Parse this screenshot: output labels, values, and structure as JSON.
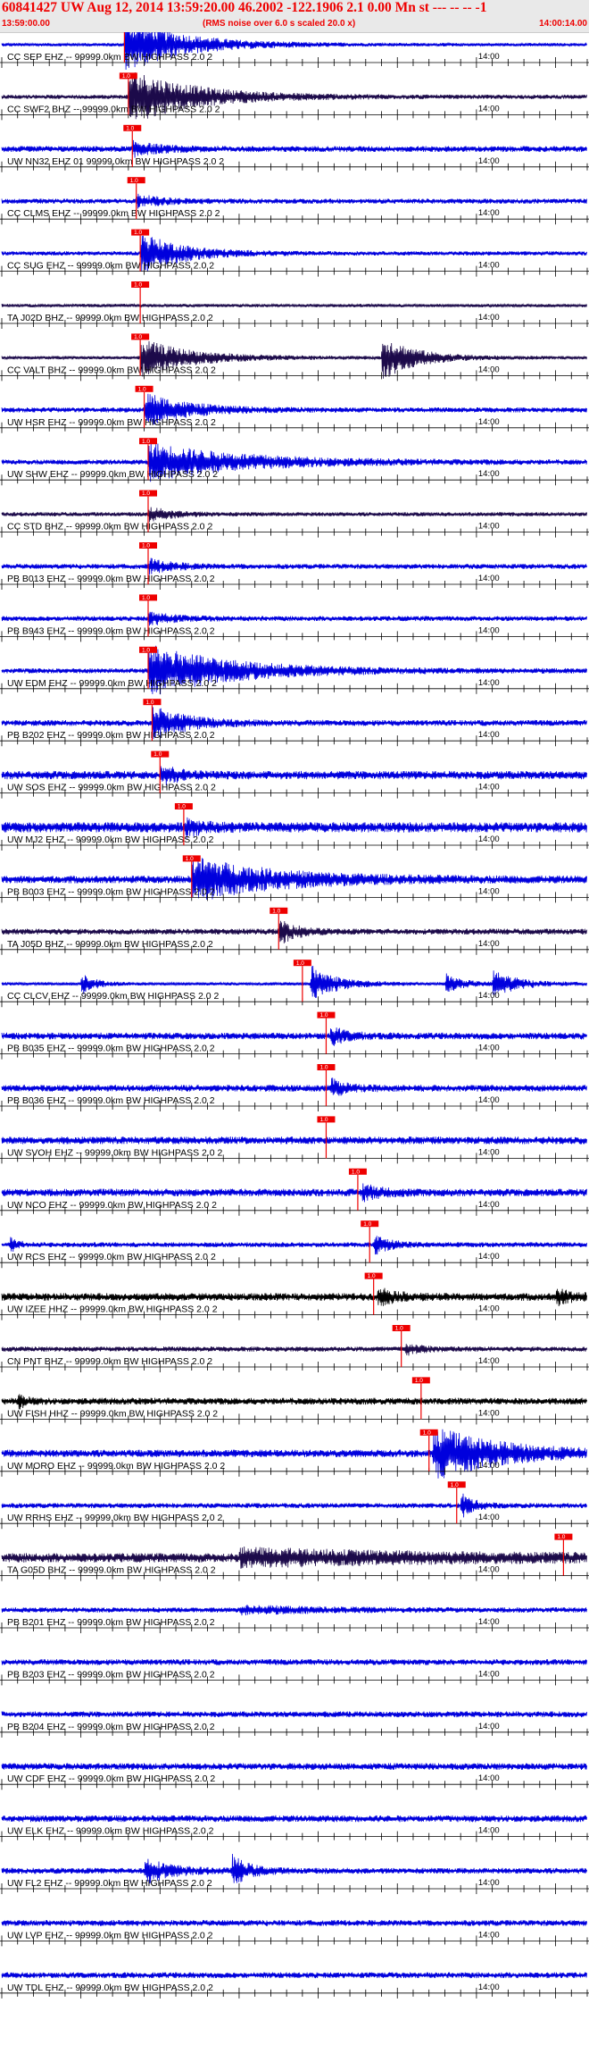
{
  "header": {
    "title": "60841427 UW Aug 12, 2014 13:59:20.00   46.2002 -122.1906  2.1 0.00 Mn st --- -- --  -1",
    "start_time": "13:59:00.00",
    "rms_note": "(RMS noise over 6.0 s scaled 20.0 x)",
    "end_time": "14:00:14.00"
  },
  "colors": {
    "trace_blue": "#0000dd",
    "trace_dark": "#1c0a4a",
    "trace_black": "#000000",
    "pick_red": "#ee0000",
    "header_red": "#ee0000"
  },
  "chart_data": {
    "type": "seismogram",
    "x_units": "seconds after 13:59:00.00",
    "x_range": [
      0,
      74
    ],
    "tick_label": "14:00",
    "tick_label_x": 60,
    "traces": [
      {
        "label": "CC SEP EHZ -- 99999.0km BW  HIGHPASS  2.0  2",
        "pick": 15.5,
        "color": "trace_blue",
        "amp": 0.2,
        "events": [
          {
            "t": 15.5,
            "a": 3.2,
            "d": 7
          }
        ]
      },
      {
        "label": "CC SWF2 BHZ -- 99999.0km BW  HIGHPASS  2.0  2",
        "pick": 16.0,
        "color": "trace_dark",
        "amp": 0.25,
        "events": [
          {
            "t": 16.0,
            "a": 3.2,
            "d": 8
          }
        ]
      },
      {
        "label": "UW NN32 EHZ 01 99999.0km BW  HIGHPASS  2.0  2",
        "pick": 16.5,
        "color": "trace_blue",
        "amp": 0.35,
        "events": [
          {
            "t": 16.5,
            "a": 0.8,
            "d": 3
          }
        ]
      },
      {
        "label": "CC CLMS EHZ -- 99999.0km BW  HIGHPASS  2.0  2",
        "pick": 17.0,
        "color": "trace_blue",
        "amp": 0.3,
        "events": [
          {
            "t": 17.0,
            "a": 0.7,
            "d": 3
          }
        ]
      },
      {
        "label": "CC SUG EHZ -- 99999.0km BW  HIGHPASS  2.0  2",
        "pick": 17.5,
        "color": "trace_blue",
        "amp": 0.25,
        "events": [
          {
            "t": 17.5,
            "a": 2.4,
            "d": 5
          }
        ]
      },
      {
        "label": "TA J02D BHZ -- 99999.0km BW  HIGHPASS  2.0  2",
        "pick": 17.5,
        "color": "trace_dark",
        "amp": 0.2,
        "events": []
      },
      {
        "label": "CC VALT BHZ -- 99999.0km BW  HIGHPASS  2.0  2",
        "pick": 17.5,
        "color": "trace_dark",
        "amp": 0.2,
        "events": [
          {
            "t": 17.5,
            "a": 2.2,
            "d": 6
          },
          {
            "t": 48.0,
            "a": 2.6,
            "d": 4
          }
        ]
      },
      {
        "label": "UW HSR EHZ -- 99999.0km BW  HIGHPASS  2.0  2",
        "pick": 18.0,
        "color": "trace_blue",
        "amp": 0.3,
        "events": [
          {
            "t": 18.0,
            "a": 2.0,
            "d": 5
          }
        ]
      },
      {
        "label": "UW SHW EHZ -- 99999.0km BW  HIGHPASS  2.0  2",
        "pick": 18.5,
        "color": "trace_blue",
        "amp": 0.3,
        "events": [
          {
            "t": 18.5,
            "a": 2.2,
            "d": 11
          }
        ]
      },
      {
        "label": "CC STD BHZ -- 99999.0km BW  HIGHPASS  2.0  2",
        "pick": 18.5,
        "color": "trace_dark",
        "amp": 0.25,
        "events": [
          {
            "t": 18.5,
            "a": 0.8,
            "d": 3
          }
        ]
      },
      {
        "label": "PB B013 EHZ -- 99999.0km BW  HIGHPASS  2.0  2",
        "pick": 18.5,
        "color": "trace_blue",
        "amp": 0.3,
        "events": [
          {
            "t": 18.5,
            "a": 0.8,
            "d": 3
          }
        ]
      },
      {
        "label": "PB B943 EHZ -- 99999.0km BW  HIGHPASS  2.0  2",
        "pick": 18.5,
        "color": "trace_blue",
        "amp": 0.3,
        "events": [
          {
            "t": 18.5,
            "a": 0.7,
            "d": 3
          }
        ]
      },
      {
        "label": "UW EDM EHZ -- 99999.0km BW  HIGHPASS  2.0  2",
        "pick": 18.5,
        "color": "trace_blue",
        "amp": 0.3,
        "events": [
          {
            "t": 18.5,
            "a": 3.0,
            "d": 10
          }
        ]
      },
      {
        "label": "PB B202 EHZ -- 99999.0km BW  HIGHPASS  2.0  2",
        "pick": 19.0,
        "color": "trace_blue",
        "amp": 0.35,
        "events": [
          {
            "t": 19.0,
            "a": 2.0,
            "d": 4
          }
        ]
      },
      {
        "label": "UW SOS EHZ -- 99999.0km BW  HIGHPASS  2.0  2",
        "pick": 20.0,
        "color": "trace_blue",
        "amp": 0.5,
        "events": [
          {
            "t": 20.0,
            "a": 1.2,
            "d": 2
          }
        ]
      },
      {
        "label": "UW MJ2 EHZ -- 99999.0km BW  HIGHPASS  2.0  2",
        "pick": 23.0,
        "color": "trace_blue",
        "amp": 0.6,
        "events": [
          {
            "t": 23.0,
            "a": 1.0,
            "d": 2
          }
        ]
      },
      {
        "label": "PB B003 EHZ -- 99999.0km BW  HIGHPASS  2.0  2",
        "pick": 24.0,
        "color": "trace_blue",
        "amp": 0.45,
        "events": [
          {
            "t": 24.0,
            "a": 2.5,
            "d": 10
          }
        ]
      },
      {
        "label": "TA J05D BHZ -- 99999.0km BW  HIGHPASS  2.0  2",
        "pick": 35.0,
        "color": "trace_dark",
        "amp": 0.35,
        "events": [
          {
            "t": 35.0,
            "a": 1.5,
            "d": 2
          }
        ]
      },
      {
        "label": "CC CLCV EHZ -- 99999.0km BW  HIGHPASS  2.0  2",
        "pick": 38.0,
        "color": "trace_blue",
        "amp": 0.2,
        "events": [
          {
            "t": 10.0,
            "a": 1.5,
            "d": 1.5
          },
          {
            "t": 39.0,
            "a": 2.2,
            "d": 3
          },
          {
            "t": 56.0,
            "a": 1.2,
            "d": 2
          },
          {
            "t": 62.0,
            "a": 1.5,
            "d": 3
          }
        ]
      },
      {
        "label": "PB B035 EHZ -- 99999.0km BW  HIGHPASS  2.0  2",
        "pick": 41.0,
        "color": "trace_blue",
        "amp": 0.4,
        "events": [
          {
            "t": 41.5,
            "a": 1.0,
            "d": 2
          }
        ]
      },
      {
        "label": "PB B036 EHZ -- 99999.0km BW  HIGHPASS  2.0  2",
        "pick": 41.0,
        "color": "trace_blue",
        "amp": 0.4,
        "events": [
          {
            "t": 41.5,
            "a": 1.0,
            "d": 2
          }
        ]
      },
      {
        "label": "UW SVOH EHZ -- 99999.0km BW  HIGHPASS  2.0  2",
        "pick": 41.0,
        "color": "trace_blue",
        "amp": 0.45,
        "events": []
      },
      {
        "label": "UW NCO EHZ -- 99999.0km BW  HIGHPASS  2.0  2",
        "pick": 45.0,
        "color": "trace_blue",
        "amp": 0.45,
        "events": [
          {
            "t": 45.5,
            "a": 1.0,
            "d": 2
          }
        ]
      },
      {
        "label": "UW RCS EHZ -- 99999.0km BW  HIGHPASS  2.0  2",
        "pick": 46.5,
        "color": "trace_blue",
        "amp": 0.3,
        "events": [
          {
            "t": 1.0,
            "a": 0.9,
            "d": 1
          },
          {
            "t": 47.0,
            "a": 1.1,
            "d": 2
          }
        ]
      },
      {
        "label": "UW IZEE HHZ -- 99999.0km BW  HIGHPASS  2.0  2",
        "pick": 47.0,
        "color": "trace_black",
        "amp": 0.45,
        "events": [
          {
            "t": 47.5,
            "a": 1.1,
            "d": 2
          },
          {
            "t": 70.0,
            "a": 0.8,
            "d": 2
          }
        ]
      },
      {
        "label": "CN PNT BHZ -- 99999.0km BW  HIGHPASS  2.0  2",
        "pick": 50.5,
        "color": "trace_dark",
        "amp": 0.3,
        "events": [
          {
            "t": 51.0,
            "a": 0.6,
            "d": 2
          }
        ]
      },
      {
        "label": "UW FISH HHZ -- 99999.0km BW  HIGHPASS  2.0  2",
        "pick": 53.0,
        "color": "trace_black",
        "amp": 0.4,
        "events": [
          {
            "t": 2.0,
            "a": 0.8,
            "d": 1
          }
        ]
      },
      {
        "label": "UW MORO EHZ -- 99999.0km BW  HIGHPASS  2.0  2",
        "pick": 54.0,
        "color": "trace_blue",
        "amp": 0.45,
        "events": [
          {
            "t": 54.5,
            "a": 3.0,
            "d": 8
          }
        ]
      },
      {
        "label": "UW RRHS EHZ -- 99999.0km BW  HIGHPASS  2.0  2",
        "pick": 57.5,
        "color": "trace_blue",
        "amp": 0.3,
        "events": [
          {
            "t": 58.0,
            "a": 1.5,
            "d": 1.5
          }
        ]
      },
      {
        "label": "TA G05D BHZ -- 99999.0km BW  HIGHPASS  2.0  2",
        "pick": 71.0,
        "color": "trace_dark",
        "amp": 0.55,
        "events": [
          {
            "t": 30.0,
            "a": 0.8,
            "d": 25
          }
        ]
      },
      {
        "label": "PB B201 EHZ -- 99999.0km BW  HIGHPASS  2.0  2",
        "pick": null,
        "color": "trace_blue",
        "amp": 0.3,
        "events": [
          {
            "t": 30.0,
            "a": 0.4,
            "d": 10
          }
        ]
      },
      {
        "label": "PB B203 EHZ -- 99999.0km BW  HIGHPASS  2.0  2",
        "pick": null,
        "color": "trace_blue",
        "amp": 0.35,
        "events": []
      },
      {
        "label": "PB B204 EHZ -- 99999.0km BW  HIGHPASS  2.0  2",
        "pick": null,
        "color": "trace_blue",
        "amp": 0.35,
        "events": []
      },
      {
        "label": "UW CDF EHZ -- 99999.0km BW  HIGHPASS  2.0  2",
        "pick": null,
        "color": "trace_blue",
        "amp": 0.4,
        "events": []
      },
      {
        "label": "UW ELK EHZ -- 99999.0km BW  HIGHPASS  2.0  2",
        "pick": null,
        "color": "trace_blue",
        "amp": 0.4,
        "events": []
      },
      {
        "label": "UW FL2 EHZ -- 99999.0km BW  HIGHPASS  2.0  2",
        "pick": null,
        "color": "trace_blue",
        "amp": 0.35,
        "events": [
          {
            "t": 18.0,
            "a": 1.5,
            "d": 3
          },
          {
            "t": 29.0,
            "a": 1.8,
            "d": 2
          }
        ]
      },
      {
        "label": "UW LVP EHZ -- 99999.0km BW  HIGHPASS  2.0  2",
        "pick": null,
        "color": "trace_blue",
        "amp": 0.35,
        "events": []
      },
      {
        "label": "UW TDL EHZ -- 99999.0km BW  HIGHPASS  2.0  2",
        "pick": null,
        "color": "trace_blue",
        "amp": 0.35,
        "events": []
      }
    ]
  }
}
